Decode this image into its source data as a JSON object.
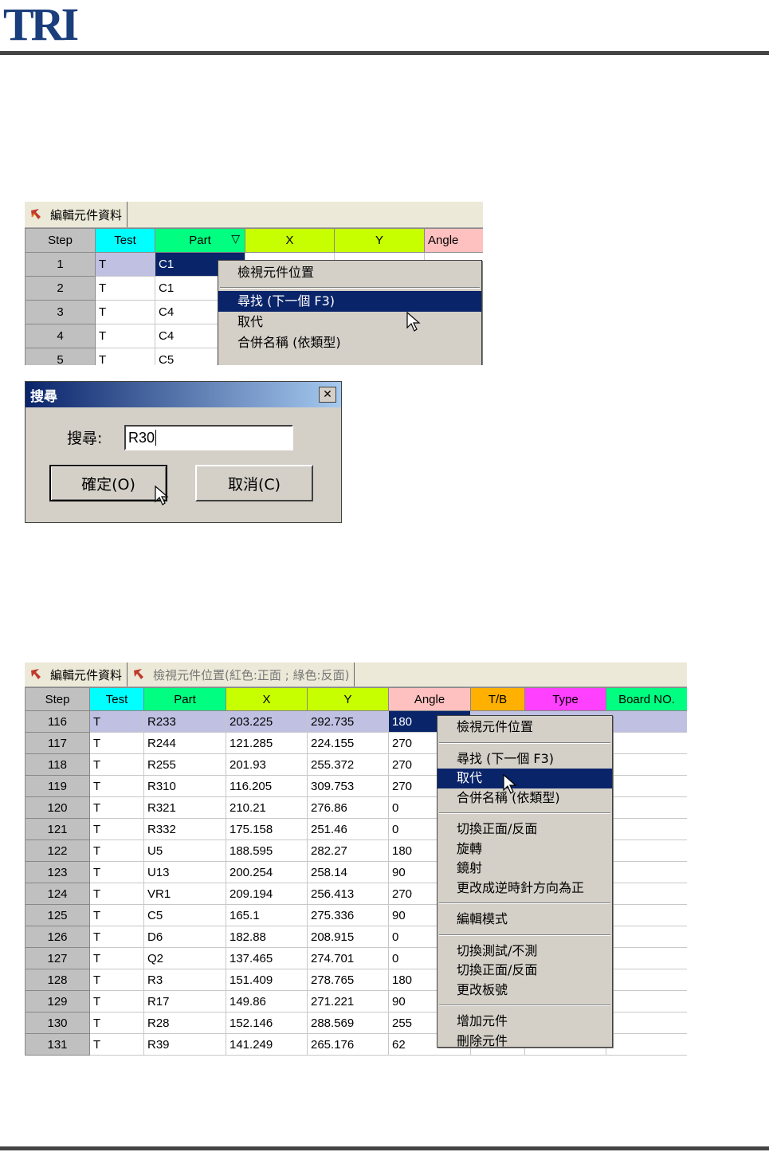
{
  "logo": {
    "text": "TRI"
  },
  "top": {
    "tab": "編輯元件資料",
    "headers": [
      "Step",
      "Test",
      "Part",
      "X",
      "Y",
      "Angle"
    ],
    "header_colors": [
      "#c0c0c0",
      "#00ffff",
      "#00ff80",
      "#c8ff00",
      "#c8ff00",
      "#ffc0c0"
    ],
    "sort_icon": "triangle-down-icon",
    "rows": [
      {
        "step": "1",
        "test": "T",
        "part": "C1",
        "x": "",
        "y": "",
        "angle": ""
      },
      {
        "step": "2",
        "test": "T",
        "part": "C1",
        "x": "",
        "y": "",
        "angle": ""
      },
      {
        "step": "3",
        "test": "T",
        "part": "C4",
        "x": "",
        "y": "",
        "angle": ""
      },
      {
        "step": "4",
        "test": "T",
        "part": "C4",
        "x": "",
        "y": "",
        "angle": ""
      },
      {
        "step": "5",
        "test": "T",
        "part": "C5",
        "x": "",
        "y": "",
        "angle": ""
      }
    ],
    "menu": [
      "檢視元件位置",
      "尋找 (下一個 F3)",
      "取代",
      "合併名稱 (依類型)"
    ]
  },
  "dialog": {
    "title": "搜尋",
    "close": "✕",
    "label": "搜尋:",
    "value": "R30",
    "ok": "確定(O)",
    "cancel": "取消(C)"
  },
  "bottom": {
    "tab1": "編輯元件資料",
    "tab2": "檢視元件位置(紅色:正面 ; 綠色:反面)",
    "headers": [
      "Step",
      "Test",
      "Part",
      "X",
      "Y",
      "Angle",
      "T/B",
      "Type",
      "Board NO."
    ],
    "header_colors": [
      "#c0c0c0",
      "#00ffff",
      "#00ff80",
      "#c8ff00",
      "#c8ff00",
      "#ffc0c0",
      "#ffb000",
      "#ff40ff",
      "#00ff80"
    ],
    "rows": [
      {
        "step": "116",
        "test": "T",
        "part": "R233",
        "x": "203.225",
        "y": "292.735",
        "angle": "180"
      },
      {
        "step": "117",
        "test": "T",
        "part": "R244",
        "x": "121.285",
        "y": "224.155",
        "angle": "270"
      },
      {
        "step": "118",
        "test": "T",
        "part": "R255",
        "x": "201.93",
        "y": "255.372",
        "angle": "270"
      },
      {
        "step": "119",
        "test": "T",
        "part": "R310",
        "x": "116.205",
        "y": "309.753",
        "angle": "270"
      },
      {
        "step": "120",
        "test": "T",
        "part": "R321",
        "x": "210.21",
        "y": "276.86",
        "angle": "0"
      },
      {
        "step": "121",
        "test": "T",
        "part": "R332",
        "x": "175.158",
        "y": "251.46",
        "angle": "0"
      },
      {
        "step": "122",
        "test": "T",
        "part": "U5",
        "x": "188.595",
        "y": "282.27",
        "angle": "180"
      },
      {
        "step": "123",
        "test": "T",
        "part": "U13",
        "x": "200.254",
        "y": "258.14",
        "angle": "90"
      },
      {
        "step": "124",
        "test": "T",
        "part": "VR1",
        "x": "209.194",
        "y": "256.413",
        "angle": "270"
      },
      {
        "step": "125",
        "test": "T",
        "part": "C5",
        "x": "165.1",
        "y": "275.336",
        "angle": "90"
      },
      {
        "step": "126",
        "test": "T",
        "part": "D6",
        "x": "182.88",
        "y": "208.915",
        "angle": "0"
      },
      {
        "step": "127",
        "test": "T",
        "part": "Q2",
        "x": "137.465",
        "y": "274.701",
        "angle": "0"
      },
      {
        "step": "128",
        "test": "T",
        "part": "R3",
        "x": "151.409",
        "y": "278.765",
        "angle": "180"
      },
      {
        "step": "129",
        "test": "T",
        "part": "R17",
        "x": "149.86",
        "y": "271.221",
        "angle": "90"
      },
      {
        "step": "130",
        "test": "T",
        "part": "R28",
        "x": "152.146",
        "y": "288.569",
        "angle": "255"
      },
      {
        "step": "131",
        "test": "T",
        "part": "R39",
        "x": "141.249",
        "y": "265.176",
        "angle": "62"
      }
    ],
    "menu": [
      [
        "檢視元件位置"
      ],
      [
        "尋找 (下一個 F3)",
        "取代",
        "合併名稱 (依類型)"
      ],
      [
        "切換正面/反面",
        "旋轉",
        "鏡射",
        "更改成逆時針方向為正"
      ],
      [
        "編輯模式"
      ],
      [
        "切換測試/不測",
        "切換正面/反面",
        "更改板號"
      ],
      [
        "增加元件",
        "刪除元件"
      ]
    ]
  }
}
